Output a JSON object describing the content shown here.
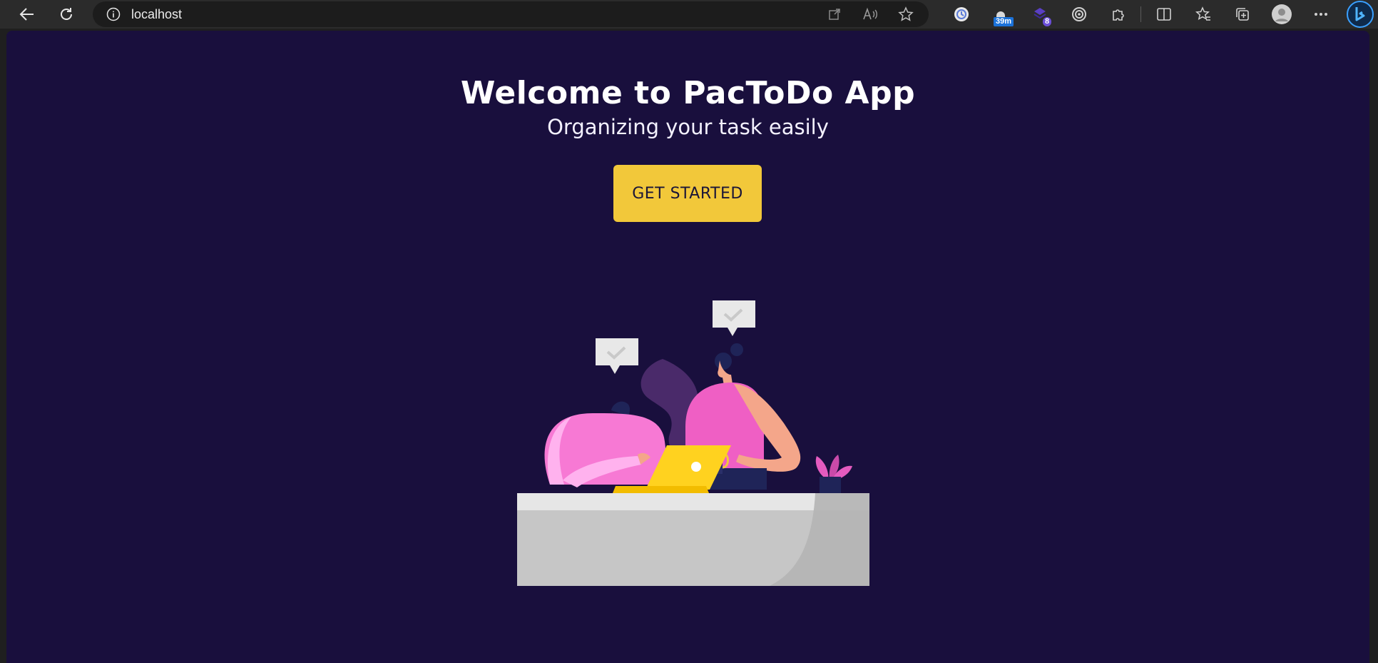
{
  "browser": {
    "address": "localhost",
    "badges": {
      "timer": "39m",
      "count": "8"
    },
    "icons": {
      "back": "arrow-left-icon",
      "refresh": "refresh-icon",
      "info": "info-icon",
      "open_app": "open-in-app-icon",
      "read_aloud": "read-aloud-icon",
      "favorite": "star-icon",
      "extensions": [
        "clock-extension-icon",
        "timer-extension-icon",
        "counter-extension-icon",
        "target-extension-icon",
        "puzzle-extensions-icon"
      ],
      "split_screen": "split-screen-icon",
      "favorites_bar": "favorites-icon",
      "collections": "collections-icon",
      "profile": "profile-avatar-icon",
      "more": "more-options-icon",
      "copilot": "bing-copilot-icon"
    }
  },
  "page": {
    "title": "Welcome to PacToDo App",
    "subtitle": "Organizing your task easily",
    "cta_label": "GET STARTED"
  },
  "colors": {
    "background": "#190f3d",
    "accent": "#f2c83a",
    "title_text": "#ffffff",
    "pink": "#f45fc7",
    "desk": "#c6c6c6"
  }
}
